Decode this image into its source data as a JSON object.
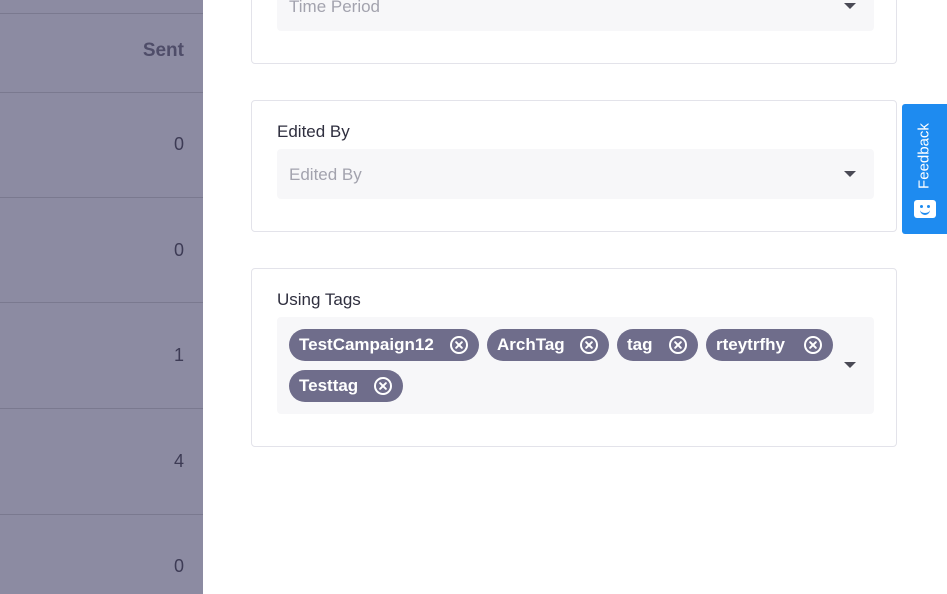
{
  "table": {
    "header": "Sent",
    "cells": [
      "0",
      "0",
      "1",
      "4",
      "0"
    ]
  },
  "filters": {
    "time_period": {
      "placeholder": "Time Period"
    },
    "edited_by": {
      "label": "Edited By",
      "placeholder": "Edited By"
    },
    "using_tags": {
      "label": "Using Tags",
      "tags": [
        "TestCampaign12",
        "ArchTag",
        "tag",
        "rteytrfhy",
        "Testtag"
      ]
    }
  },
  "feedback": {
    "label": "Feedback"
  },
  "colors": {
    "tag_bg": "#6f6d8b",
    "feedback_bg": "#1e8bf0",
    "overlay": "#8c8ba2"
  }
}
